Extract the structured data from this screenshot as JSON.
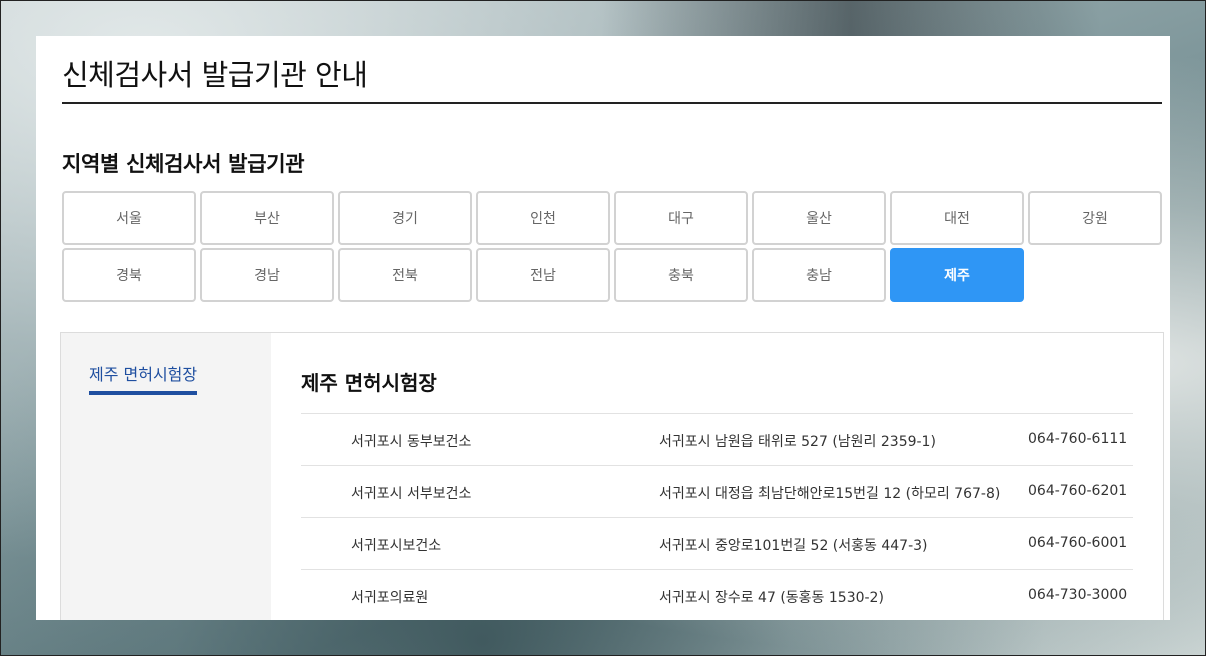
{
  "page": {
    "title": "신체검사서 발급기관 안내"
  },
  "section": {
    "title": "지역별 신체검사서 발급기관"
  },
  "regions": [
    {
      "label": "서울"
    },
    {
      "label": "부산"
    },
    {
      "label": "경기"
    },
    {
      "label": "인천"
    },
    {
      "label": "대구"
    },
    {
      "label": "울산"
    },
    {
      "label": "대전"
    },
    {
      "label": "강원"
    },
    {
      "label": "경북"
    },
    {
      "label": "경남"
    },
    {
      "label": "전북"
    },
    {
      "label": "전남"
    },
    {
      "label": "충북"
    },
    {
      "label": "충남"
    },
    {
      "label": "제주"
    }
  ],
  "selected_region": "제주",
  "colors": {
    "accent": "#2f96f5",
    "tab_underline": "#1f4fa0"
  },
  "side": {
    "tab_label": "제주 면허시험장"
  },
  "main": {
    "title": "제주 면허시험장",
    "institutions": [
      {
        "name": "서귀포시 동부보건소",
        "address": "서귀포시 남원읍 태위로 527 (남원리 2359-1)",
        "phone": "064-760-6111"
      },
      {
        "name": "서귀포시 서부보건소",
        "address": "서귀포시 대정읍 최남단해안로15번길 12 (하모리 767-8)",
        "phone": "064-760-6201"
      },
      {
        "name": "서귀포시보건소",
        "address": "서귀포시 중앙로101번길 52 (서홍동 447-3)",
        "phone": "064-760-6001"
      },
      {
        "name": "서귀포의료원",
        "address": "서귀포시 장수로 47 (동홍동 1530-2)",
        "phone": "064-730-3000"
      }
    ]
  }
}
